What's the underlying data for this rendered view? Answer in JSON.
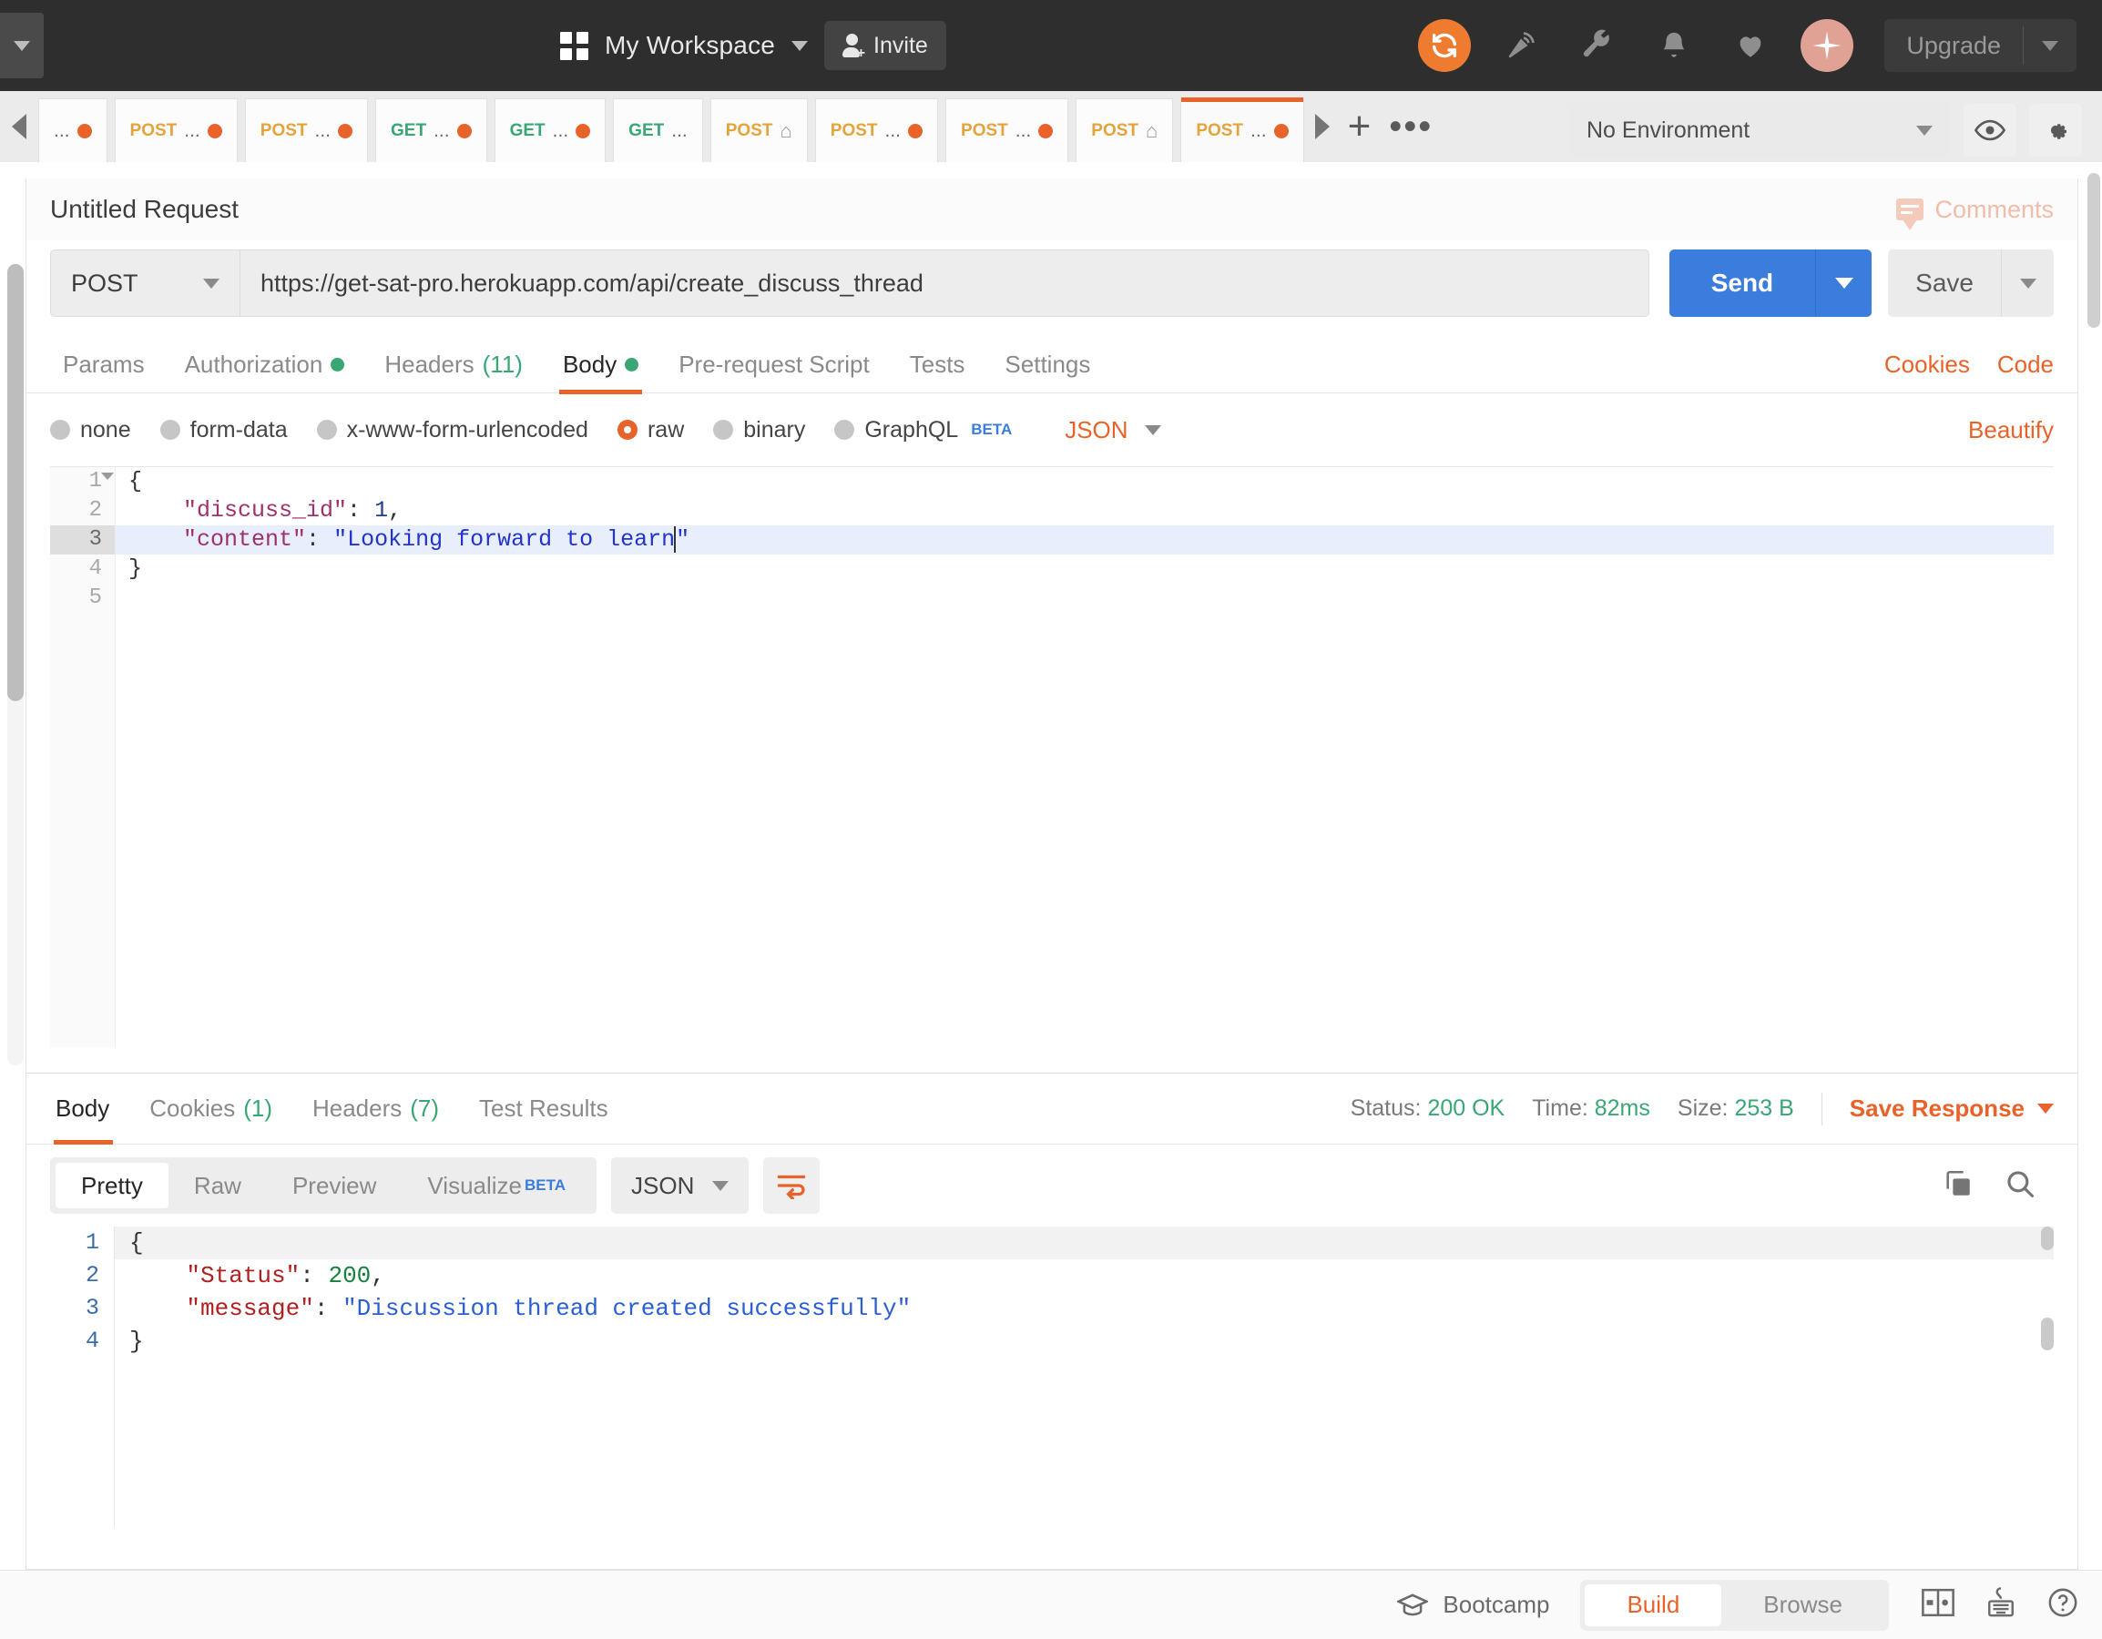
{
  "topbar": {
    "workspace_name": "My Workspace",
    "invite_label": "Invite",
    "upgrade_label": "Upgrade",
    "icons": [
      "sync-icon",
      "satellite-icon",
      "wrench-icon",
      "bell-icon",
      "heart-icon",
      "sparkle-icon"
    ]
  },
  "tabs": [
    {
      "method": "",
      "name": "...",
      "dirty": true,
      "active": false
    },
    {
      "method": "POST",
      "name": "...",
      "dirty": true,
      "active": false
    },
    {
      "method": "POST",
      "name": "...",
      "dirty": true,
      "active": false
    },
    {
      "method": "GET",
      "name": "...",
      "dirty": true,
      "active": false
    },
    {
      "method": "GET",
      "name": "...",
      "dirty": true,
      "active": false
    },
    {
      "method": "GET",
      "name": "...",
      "dirty": false,
      "active": false
    },
    {
      "method": "POST",
      "name": "",
      "dirty": false,
      "active": false
    },
    {
      "method": "POST",
      "name": "...",
      "dirty": true,
      "active": false
    },
    {
      "method": "POST",
      "name": "...",
      "dirty": true,
      "active": false
    },
    {
      "method": "POST",
      "name": "",
      "dirty": false,
      "active": false
    },
    {
      "method": "POST",
      "name": "...",
      "dirty": true,
      "active": true
    }
  ],
  "environment": {
    "selected": "No Environment",
    "eye_icon": "eye-icon",
    "settings_icon": "gear-icon"
  },
  "request": {
    "title": "Untitled Request",
    "comments_label": "Comments",
    "method": "POST",
    "url": "https://get-sat-pro.herokuapp.com/api/create_discuss_thread",
    "send_label": "Send",
    "save_label": "Save",
    "tabs": [
      {
        "label": "Params",
        "badge": "",
        "dot": false,
        "active": false
      },
      {
        "label": "Authorization",
        "badge": "",
        "dot": true,
        "active": false
      },
      {
        "label": "Headers",
        "badge": "(11)",
        "dot": false,
        "active": false
      },
      {
        "label": "Body",
        "badge": "",
        "dot": true,
        "active": true
      },
      {
        "label": "Pre-request Script",
        "badge": "",
        "dot": false,
        "active": false
      },
      {
        "label": "Tests",
        "badge": "",
        "dot": false,
        "active": false
      },
      {
        "label": "Settings",
        "badge": "",
        "dot": false,
        "active": false
      }
    ],
    "cookies_label": "Cookies",
    "code_label": "Code",
    "body_types": [
      {
        "label": "none",
        "selected": false
      },
      {
        "label": "form-data",
        "selected": false
      },
      {
        "label": "x-www-form-urlencoded",
        "selected": false
      },
      {
        "label": "raw",
        "selected": true
      },
      {
        "label": "binary",
        "selected": false
      },
      {
        "label": "GraphQL",
        "selected": false,
        "beta": "BETA"
      }
    ],
    "raw_format": "JSON",
    "beautify_label": "Beautify",
    "editor": {
      "line_numbers": [
        "1",
        "2",
        "3",
        "4",
        "5"
      ],
      "current_line": 3,
      "lines": [
        {
          "open_brace": "{"
        },
        {
          "key": "\"discuss_id\"",
          "colon": ": ",
          "num": "1",
          "comma": ","
        },
        {
          "key": "\"content\"",
          "colon": ": ",
          "str": "\"Looking forward to learn",
          "tail": "\""
        },
        {
          "close_brace": "}"
        },
        {
          "empty": ""
        }
      ]
    }
  },
  "response": {
    "tabs": [
      {
        "label": "Body",
        "badge": "",
        "active": true
      },
      {
        "label": "Cookies",
        "badge": "(1)",
        "active": false
      },
      {
        "label": "Headers",
        "badge": "(7)",
        "active": false
      },
      {
        "label": "Test Results",
        "badge": "",
        "active": false
      }
    ],
    "status_label": "Status:",
    "status_value": "200 OK",
    "time_label": "Time:",
    "time_value": "82ms",
    "size_label": "Size:",
    "size_value": "253 B",
    "save_response_label": "Save Response",
    "view_modes": [
      {
        "label": "Pretty",
        "active": true
      },
      {
        "label": "Raw",
        "active": false
      },
      {
        "label": "Preview",
        "active": false
      },
      {
        "label": "Visualize",
        "active": false,
        "beta": "BETA"
      }
    ],
    "format": "JSON",
    "wrap_icon": "word-wrap-icon",
    "copy_icon": "copy-icon",
    "search_icon": "search-icon",
    "body": {
      "line_numbers": [
        "1",
        "2",
        "3",
        "4"
      ],
      "lines": [
        {
          "open_brace": "{"
        },
        {
          "key": "\"Status\"",
          "colon": ": ",
          "num": "200",
          "comma": ","
        },
        {
          "key": "\"message\"",
          "colon": ": ",
          "str": "\"Discussion thread created successfully\""
        },
        {
          "close_brace": "}"
        }
      ]
    }
  },
  "bottombar": {
    "bootcamp_label": "Bootcamp",
    "build_label": "Build",
    "browse_label": "Browse",
    "icons": [
      "two-pane-icon",
      "keyboard-shortcut-icon",
      "help-icon"
    ]
  },
  "colors": {
    "accent": "#e8632a",
    "send_blue": "#3b7ddd",
    "green": "#3aa675",
    "post_orange": "#e5a33c",
    "dark_bar": "#2e2e2e"
  }
}
